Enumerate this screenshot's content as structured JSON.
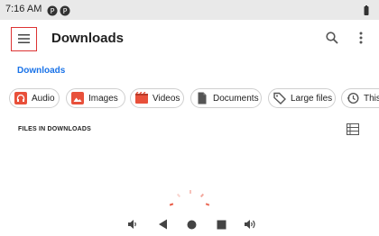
{
  "status_bar": {
    "time": "7:16 AM",
    "icons": [
      "notification-icon",
      "notification-icon",
      "battery-icon"
    ]
  },
  "app_bar": {
    "title": "Downloads",
    "icons": [
      "menu-icon",
      "search-icon",
      "more-vert-icon"
    ]
  },
  "breadcrumb": {
    "label": "Downloads"
  },
  "filter_chips": [
    {
      "label": "Audio",
      "icon": "audio-icon",
      "color": "#e8503a"
    },
    {
      "label": "Images",
      "icon": "image-icon",
      "color": "#e8503a"
    },
    {
      "label": "Videos",
      "icon": "video-icon",
      "color": "#e8503a"
    },
    {
      "label": "Documents",
      "icon": "document-icon",
      "color": "#555555"
    },
    {
      "label": "Large files",
      "icon": "tag-icon",
      "color": "#555555"
    },
    {
      "label": "This",
      "icon": "history-icon",
      "color": "#555555"
    }
  ],
  "files_section": {
    "label": "FILES IN DOWNLOADS",
    "view_icon": "list-view-icon"
  },
  "nav_bar": {
    "icons": [
      "volume-down-icon",
      "back-icon",
      "home-icon",
      "recents-icon",
      "volume-up-icon"
    ]
  },
  "colors": {
    "accent": "#1a73e8",
    "chip_accent": "#e8503a",
    "status_bar_bg": "#e9e9e9",
    "highlight_border": "#dd3333"
  }
}
